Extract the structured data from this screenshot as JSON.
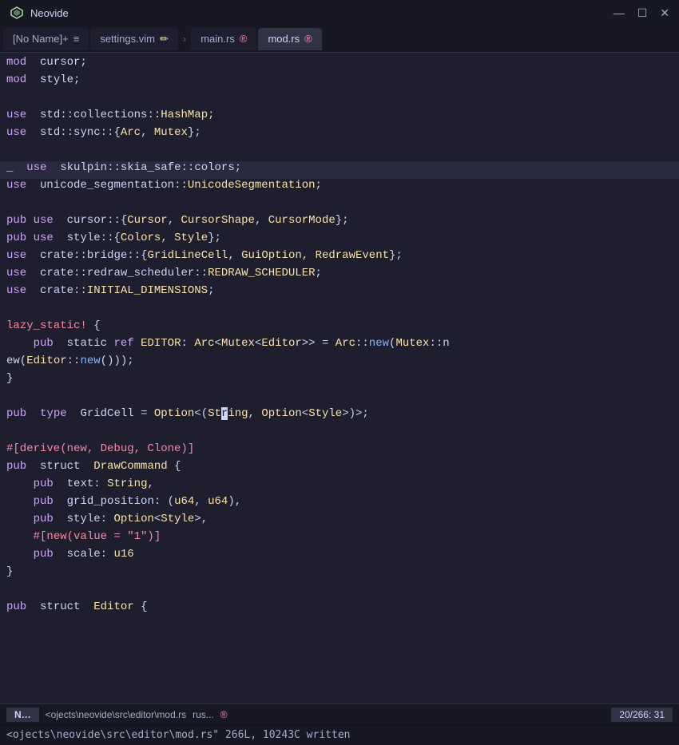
{
  "titleBar": {
    "appName": "Neovide",
    "controls": [
      "—",
      "☐",
      "✕"
    ]
  },
  "tabs": [
    {
      "label": "[No Name]+",
      "icon": "≡",
      "active": false
    },
    {
      "label": "settings.vim",
      "icon": "✏",
      "active": false
    },
    {
      "label": "main.rs",
      "icon": "®",
      "active": false
    },
    {
      "label": "mod.rs",
      "icon": "®",
      "active": true
    }
  ],
  "statusBar": {
    "mode": "N...",
    "file": "<ojects\\neovide\\src\\editor\\mod.rs",
    "filetype": "rus...",
    "fileicon": "®",
    "position": "20/266: 31"
  },
  "cmdLine": {
    "text": "<ojects\\neovide\\src\\editor\\mod.rs\" 266L, 10243C written"
  }
}
